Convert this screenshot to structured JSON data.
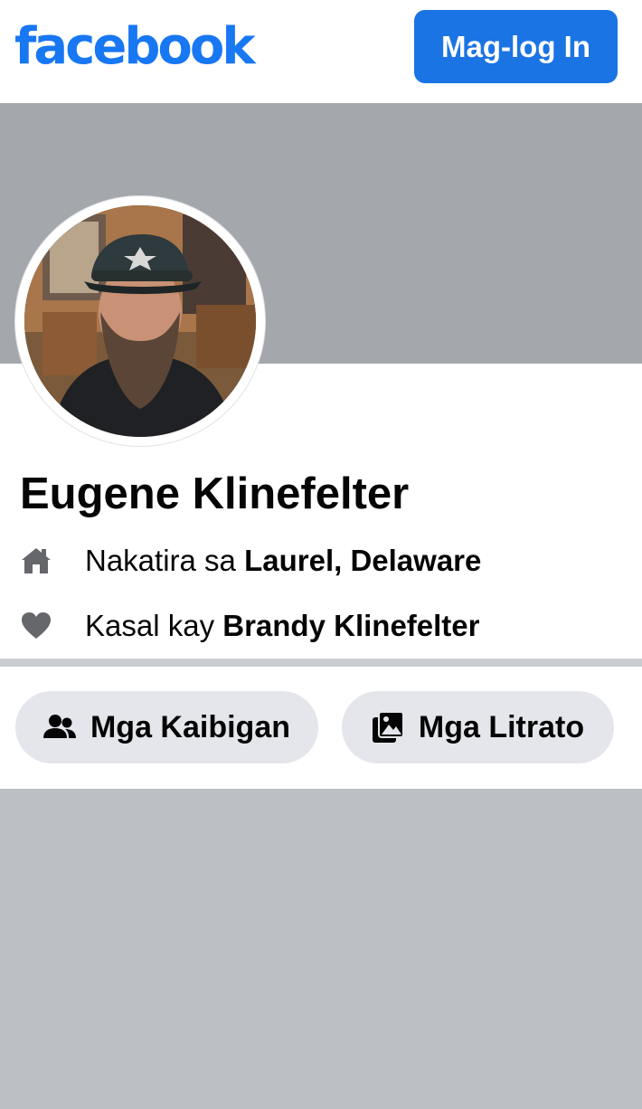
{
  "header": {
    "logo_text": "facebook",
    "login_label": "Mag-log In",
    "brand_color": "#1877f2"
  },
  "profile": {
    "name": "Eugene Klinefelter",
    "lives_prefix": "Nakatira sa ",
    "lives_place": "Laurel, Delaware",
    "married_prefix": "Kasal kay ",
    "married_to": "Brandy Klinefelter"
  },
  "tabs": {
    "friends_label": "Mga Kaibigan",
    "photos_label": "Mga Litrato"
  },
  "icons": {
    "home": "home-icon",
    "heart": "heart-icon",
    "friends": "friends-icon",
    "photos": "photos-icon"
  }
}
